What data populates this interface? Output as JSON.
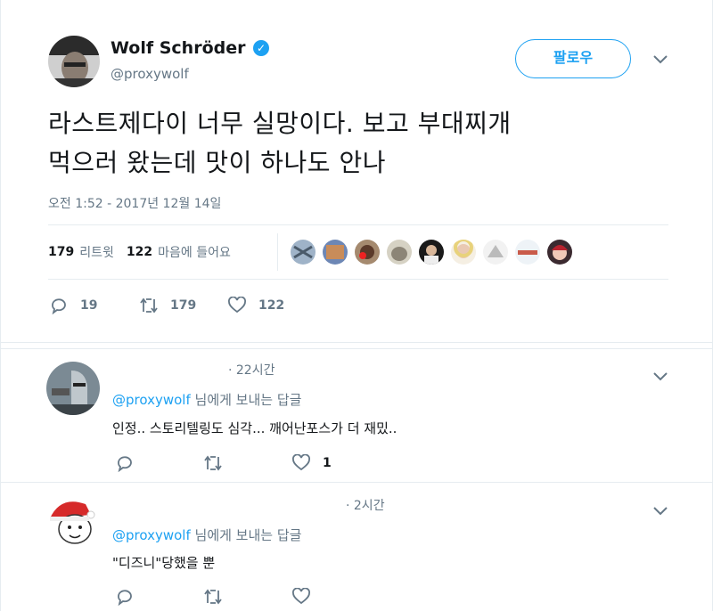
{
  "tweet": {
    "author_name": "Wolf Schröder",
    "author_handle": "@proxywolf",
    "follow_label": "팔로우",
    "text_line1": "라스트제다이 너무 실망이다. 보고 부대찌개",
    "text_line2": "먹으러 왔는데 맛이 하나도 안나",
    "timestamp": "오전 1:52 - 2017년 12월 14일",
    "retweet_count": "179",
    "retweet_label": "리트윗",
    "like_count": "122",
    "like_label": "마음에 들어요",
    "liker_avatars": [
      "avatar-1",
      "avatar-2",
      "avatar-3",
      "avatar-4",
      "avatar-5",
      "avatar-6",
      "avatar-7",
      "avatar-8",
      "avatar-9"
    ],
    "actions": {
      "reply_count": "19",
      "retweet_count": "179",
      "like_count": "122"
    }
  },
  "replies": [
    {
      "time": "· 22시간",
      "reply_to_handle": "@proxywolf",
      "reply_to_suffix": "님에게 보내는 답글",
      "text": "인정.. 스토리텔링도 심각... 깨어난포스가 더 재밌..",
      "like_count": "1"
    },
    {
      "time": "· 2시간",
      "reply_to_handle": "@proxywolf",
      "reply_to_suffix": "님에게 보내는 답글",
      "text": "\"디즈니\"당했을 뿐",
      "like_count": ""
    }
  ],
  "colors": {
    "accent": "#1da1f2",
    "muted": "#657786",
    "text": "#14171a",
    "border": "#e6ecf0"
  }
}
